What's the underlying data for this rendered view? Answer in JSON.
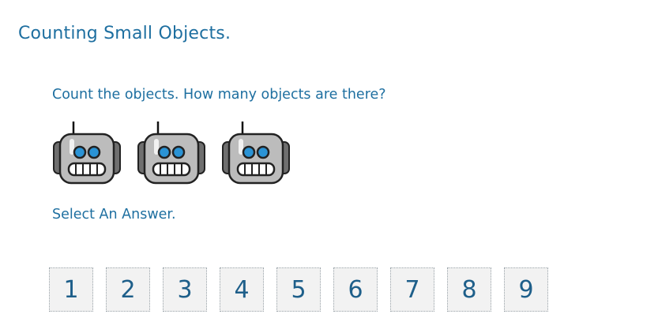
{
  "title": "Counting Small Objects.",
  "question": "Count the objects. How many objects are there?",
  "objects": [
    {
      "icon": "robot-icon"
    },
    {
      "icon": "robot-icon"
    },
    {
      "icon": "robot-icon"
    }
  ],
  "prompt": "Select An Answer.",
  "answers": [
    "1",
    "2",
    "3",
    "4",
    "5",
    "6",
    "7",
    "8",
    "9"
  ],
  "colors": {
    "text": "#1e6fa0",
    "answer_bg": "#f2f2f2",
    "robot_body": "#b9b9b9",
    "robot_eye": "#1e8fd0"
  }
}
